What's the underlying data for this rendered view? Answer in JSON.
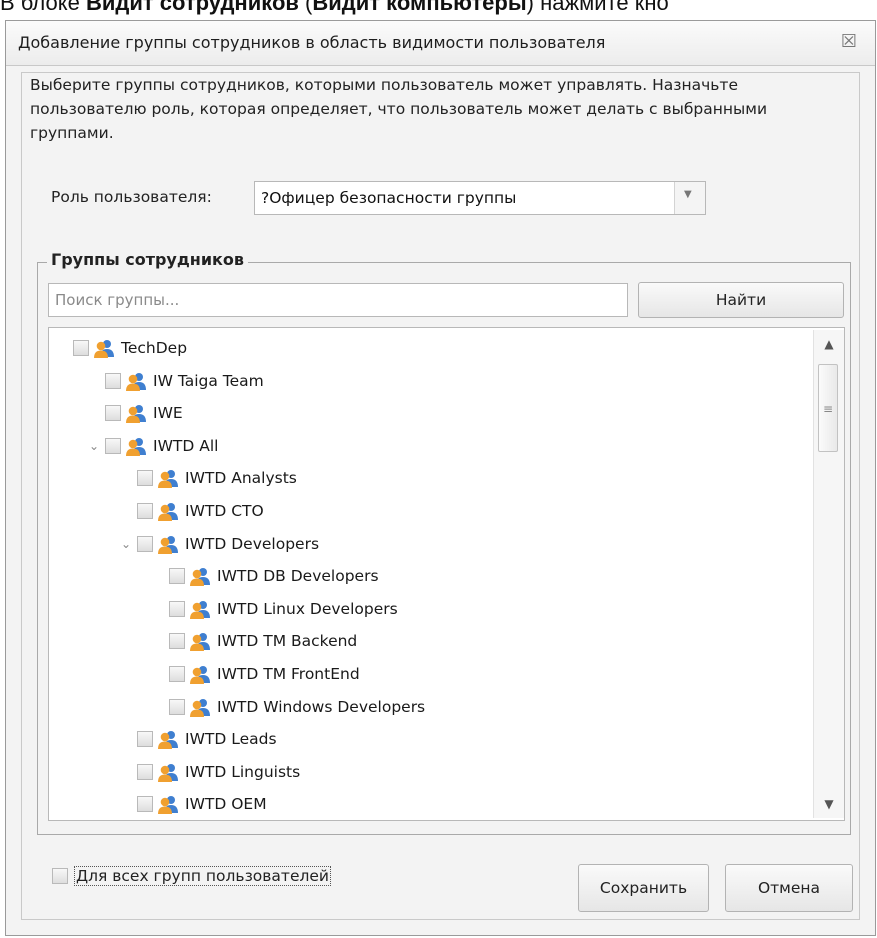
{
  "document": {
    "top_text_prefix": "В блоке ",
    "top_text_bold1": "Видит сотрудников",
    "top_text_mid": " (",
    "top_text_bold2": "Видит компьютеры",
    "top_text_suffix": ") нажмите кно"
  },
  "dialog": {
    "title": "Добавление группы сотрудников в область видимости пользователя",
    "close_glyph": "☒",
    "description": "Выберите группы сотрудников, которыми пользователь может управлять. Назначьте пользователю роль, которая определяет, что пользователь может делать с выбранными группами.",
    "role_label": "Роль пользователя:",
    "role_value": "?Офицер безопасности группы",
    "groups_legend": "Группы сотрудников",
    "search_placeholder": "Поиск группы...",
    "find_button": "Найти",
    "tree": [
      {
        "label": "TechDep",
        "level": 0,
        "expanded": null,
        "checked": false
      },
      {
        "label": "IW Taiga Team",
        "level": 1,
        "expanded": null,
        "checked": false
      },
      {
        "label": "IWE",
        "level": 1,
        "expanded": null,
        "checked": false
      },
      {
        "label": "IWTD All",
        "level": 1,
        "expanded": true,
        "checked": false
      },
      {
        "label": "IWTD Analysts",
        "level": 2,
        "expanded": null,
        "checked": false
      },
      {
        "label": "IWTD CTO",
        "level": 2,
        "expanded": null,
        "checked": false
      },
      {
        "label": "IWTD Developers",
        "level": 2,
        "expanded": true,
        "checked": false
      },
      {
        "label": "IWTD DB Developers",
        "level": 3,
        "expanded": null,
        "checked": false
      },
      {
        "label": "IWTD Linux Developers",
        "level": 3,
        "expanded": null,
        "checked": false
      },
      {
        "label": "IWTD TM Backend",
        "level": 3,
        "expanded": null,
        "checked": false
      },
      {
        "label": "IWTD TM FrontEnd",
        "level": 3,
        "expanded": null,
        "checked": false
      },
      {
        "label": "IWTD Windows Developers",
        "level": 3,
        "expanded": null,
        "checked": false
      },
      {
        "label": "IWTD Leads",
        "level": 2,
        "expanded": null,
        "checked": false
      },
      {
        "label": "IWTD Linguists",
        "level": 2,
        "expanded": null,
        "checked": false
      },
      {
        "label": "IWTD OEM",
        "level": 2,
        "expanded": null,
        "checked": false
      }
    ],
    "all_groups_label": "Для всех групп пользователей",
    "save_button": "Сохранить",
    "cancel_button": "Отмена"
  },
  "icons": {
    "group_icon": "users-group-icon",
    "expander_icon": "chevron-down-icon",
    "scroll_up": "▲",
    "scroll_down": "▼",
    "scroll_grip": "≡",
    "dropdown": "▼",
    "expanded_glyph": "⌄"
  },
  "colors": {
    "icon_orange": "#f0a030",
    "icon_blue": "#3f7fd0",
    "dialog_bg": "#f3f3f3"
  }
}
